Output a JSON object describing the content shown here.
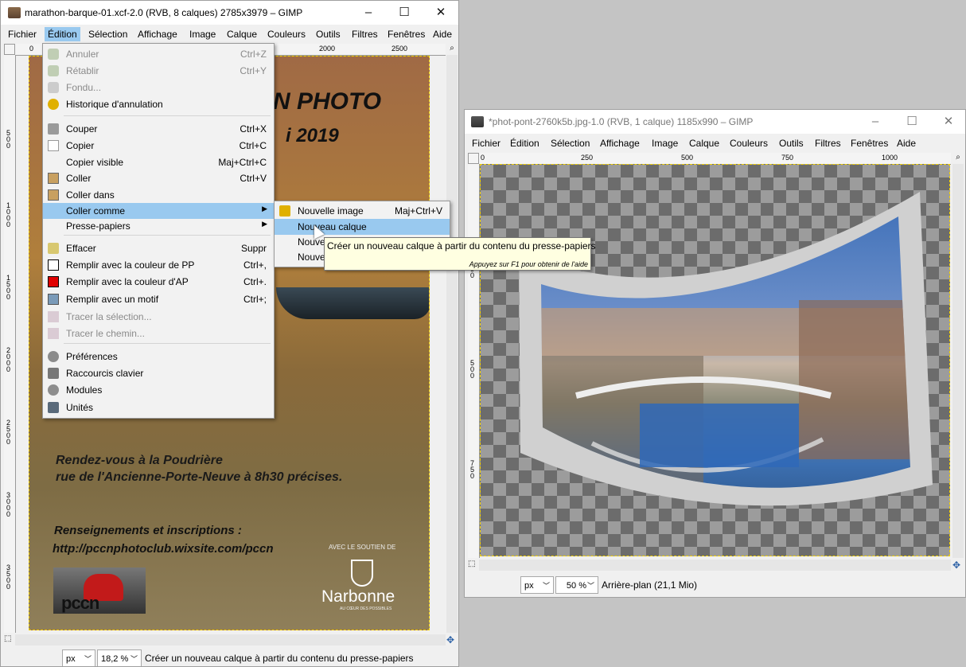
{
  "window1": {
    "title": "marathon-barque-01.xcf-2.0 (RVB, 8 calques) 2785x3979 – GIMP",
    "menus": [
      "Fichier",
      "Édition",
      "Sélection",
      "Affichage",
      "Image",
      "Calque",
      "Couleurs",
      "Outils",
      "Filtres",
      "Fenêtres",
      "Aide"
    ],
    "ruler_h": [
      "0",
      "2000",
      "2500"
    ],
    "ruler_v": [
      "5\n0\n0",
      "1\n0\n0\n0",
      "1\n5\n0\n0",
      "2\n0\n0\n0",
      "2\n5\n0\n0",
      "3\n0\n0\n0",
      "3\n5\n0\n0"
    ],
    "poster": {
      "title1": "N PHOTO",
      "title2": "i 2019",
      "line1": "Rendez-vous à la Poudrière",
      "line2": "rue de l'Ancienne-Porte-Neuve à 8h30 précises.",
      "line3": "Renseignements et inscriptions :",
      "line4": "http://pccnphotoclub.wixsite.com/pccn",
      "sponsor": "AVEC LE SOUTIEN DE",
      "city": "Narbonne",
      "city_sub": "AU CŒUR DES POSSIBLES",
      "logo": "pccn"
    },
    "status": {
      "unit": "px",
      "zoom": "18,2 %",
      "message": "Créer un nouveau calque à partir du contenu du presse-papiers"
    }
  },
  "window2": {
    "title": "*phot-pont-2760k5b.jpg-1.0 (RVB, 1 calque) 1185x990 – GIMP",
    "menus": [
      "Fichier",
      "Édition",
      "Sélection",
      "Affichage",
      "Image",
      "Calque",
      "Couleurs",
      "Outils",
      "Filtres",
      "Fenêtres",
      "Aide"
    ],
    "ruler_h": [
      "0",
      "250",
      "500",
      "750",
      "1000"
    ],
    "ruler_v": [
      "2\n5\n0",
      "5\n0\n0",
      "7\n5\n0"
    ],
    "status": {
      "unit": "px",
      "zoom": "50 %",
      "layer": "Arrière-plan (21,1 Mio)"
    }
  },
  "edit_menu": [
    {
      "label": "Annuler",
      "shortcut": "Ctrl+Z",
      "disabled": true,
      "icon": "undo-icon"
    },
    {
      "label": "Rétablir",
      "shortcut": "Ctrl+Y",
      "disabled": true,
      "icon": "redo-icon"
    },
    {
      "label": "Fondu...",
      "shortcut": "",
      "disabled": true,
      "icon": "fade-icon"
    },
    {
      "label": "Historique d'annulation",
      "shortcut": "",
      "disabled": false,
      "icon": "history-icon"
    },
    {
      "label": "Couper",
      "shortcut": "Ctrl+X",
      "disabled": false,
      "icon": "cut-icon"
    },
    {
      "label": "Copier",
      "shortcut": "Ctrl+C",
      "disabled": false,
      "icon": "copy-icon"
    },
    {
      "label": "Copier visible",
      "shortcut": "Maj+Ctrl+C",
      "disabled": false,
      "icon": ""
    },
    {
      "label": "Coller",
      "shortcut": "Ctrl+V",
      "disabled": false,
      "icon": "paste-icon"
    },
    {
      "label": "Coller dans",
      "shortcut": "",
      "disabled": false,
      "icon": "paste-into-icon"
    },
    {
      "label": "Coller comme",
      "shortcut": "",
      "disabled": false,
      "icon": "",
      "submenu": true,
      "highlighted": true
    },
    {
      "label": "Presse-papiers",
      "shortcut": "",
      "disabled": false,
      "icon": "",
      "submenu": true
    },
    {
      "label": "Effacer",
      "shortcut": "Suppr",
      "disabled": false,
      "icon": "clear-icon"
    },
    {
      "label": "Remplir avec la couleur de PP",
      "shortcut": "Ctrl+,",
      "disabled": false,
      "icon": "fill-fg-icon"
    },
    {
      "label": "Remplir avec la couleur d'AP",
      "shortcut": "Ctrl+.",
      "disabled": false,
      "icon": "fill-bg-icon"
    },
    {
      "label": "Remplir avec un motif",
      "shortcut": "Ctrl+;",
      "disabled": false,
      "icon": "fill-pattern-icon"
    },
    {
      "label": "Tracer la sélection...",
      "shortcut": "",
      "disabled": true,
      "icon": "stroke-selection-icon"
    },
    {
      "label": "Tracer le chemin...",
      "shortcut": "",
      "disabled": true,
      "icon": "stroke-path-icon"
    },
    {
      "label": "Préférences",
      "shortcut": "",
      "disabled": false,
      "icon": "preferences-icon"
    },
    {
      "label": "Raccourcis clavier",
      "shortcut": "",
      "disabled": false,
      "icon": "keyboard-icon"
    },
    {
      "label": "Modules",
      "shortcut": "",
      "disabled": false,
      "icon": "modules-icon"
    },
    {
      "label": "Unités",
      "shortcut": "",
      "disabled": false,
      "icon": "units-icon"
    }
  ],
  "paste_as_menu": [
    {
      "label": "Nouvelle image",
      "shortcut": "Maj+Ctrl+V",
      "icon": "new-image-icon"
    },
    {
      "label": "Nouveau calque",
      "shortcut": "",
      "highlighted": true
    },
    {
      "label": "Nouve",
      "shortcut": ""
    },
    {
      "label": "Nouve",
      "shortcut": ""
    }
  ],
  "tooltip": {
    "text": "Créer un nouveau calque à partir du contenu du presse-papiers",
    "hint": "Appuyez sur F1 pour obtenir de l'aide"
  },
  "colors": {
    "highlight": "#99c9ef",
    "fill_bg": "#e00000",
    "tooltip_bg": "#ffffe1",
    "selection_marquee": "#f2d000"
  }
}
